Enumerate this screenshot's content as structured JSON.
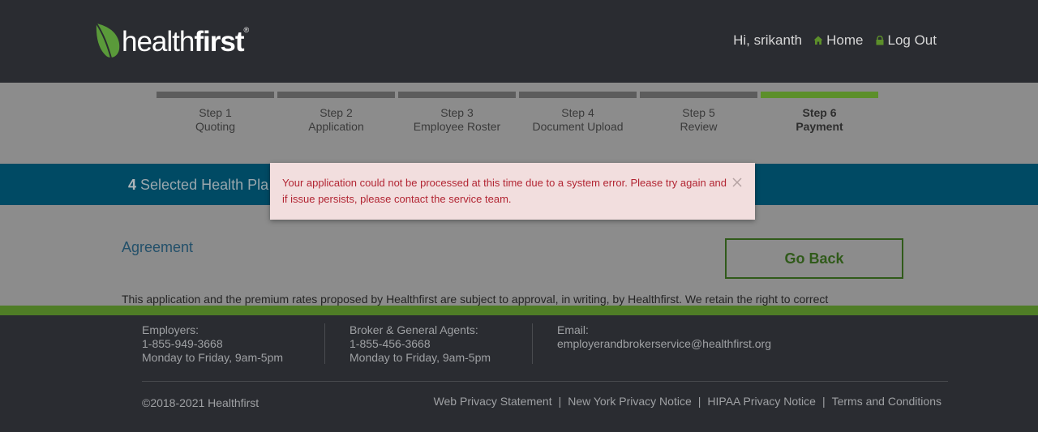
{
  "header": {
    "logo_light": "health",
    "logo_bold": "first",
    "logo_mark": "®",
    "greeting": "Hi, srikanth",
    "home_label": "Home",
    "logout_label": "Log Out"
  },
  "steps": [
    {
      "num": "Step 1",
      "name": "Quoting"
    },
    {
      "num": "Step 2",
      "name": "Application"
    },
    {
      "num": "Step 3",
      "name": "Employee Roster"
    },
    {
      "num": "Step 4",
      "name": "Document Upload"
    },
    {
      "num": "Step 5",
      "name": "Review"
    },
    {
      "num": "Step 6",
      "name": "Payment"
    }
  ],
  "active_step": 6,
  "banner": {
    "count": "4",
    "label": "Selected Health Pla"
  },
  "content": {
    "agreement_title": "Agreement",
    "go_back_label": "Go Back",
    "agreement_text": "This application and the premium rates proposed by Healthfirst are subject to approval, in writing, by Healthfirst. We retain the right to correct"
  },
  "alert": {
    "message": "Your application could not be processed at this time due to a system error.  Please try again and if issue persists, please contact the service team."
  },
  "footer": {
    "employers_label": "Employers:",
    "employers_phone": "1-855-949-3668",
    "employers_hours": "Monday to Friday, 9am-5pm",
    "broker_label": "Broker & General Agents:",
    "broker_phone": "1-855-456-3668",
    "broker_hours": "Monday to Friday, 9am-5pm",
    "email_label": "Email:",
    "email_value": "employerandbrokerservice@healthfirst.org",
    "copyright": "©2018-2021 Healthfirst",
    "links": [
      "Web Privacy Statement",
      "New York Privacy Notice",
      "HIPAA Privacy Notice",
      "Terms and Conditions"
    ],
    "link_separator": "|"
  },
  "colors": {
    "header_bg": "#2a2c31",
    "brand_green": "#5c8f2a",
    "alert_bg": "#f2dede",
    "alert_text": "#b22533",
    "banner_bg": "#004a64"
  },
  "icons": {
    "logo": "leaf-icon",
    "home": "home-icon",
    "logout": "lock-icon",
    "close": "close-icon"
  }
}
